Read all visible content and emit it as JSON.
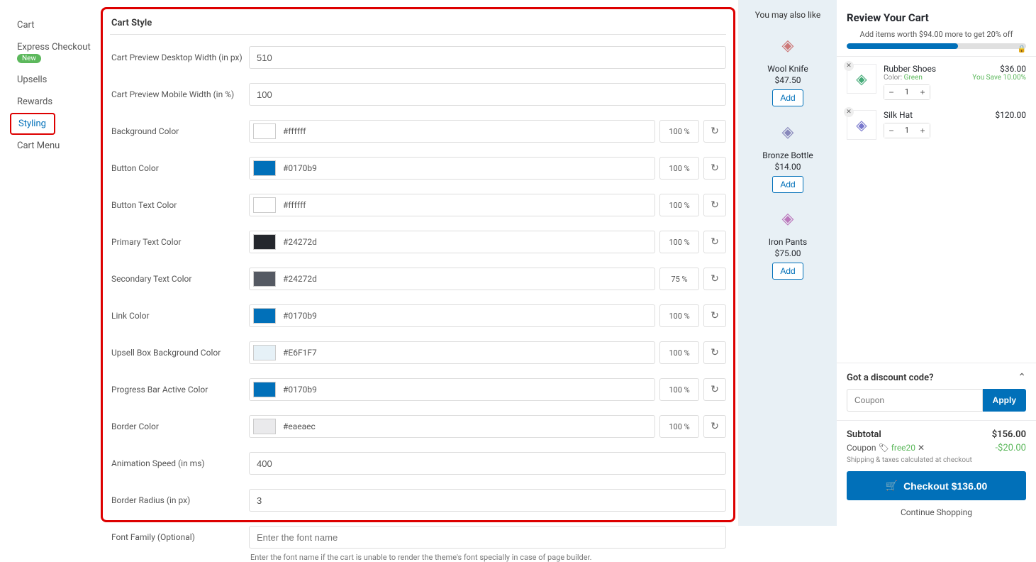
{
  "sidebar": {
    "items": [
      {
        "label": "Cart"
      },
      {
        "label": "Express Checkout",
        "badge": "New"
      },
      {
        "label": "Upsells"
      },
      {
        "label": "Rewards"
      },
      {
        "label": "Styling",
        "active": true
      },
      {
        "label": "Cart Menu"
      }
    ]
  },
  "panel": {
    "title": "Cart Style",
    "fields": {
      "desktop_width": {
        "label": "Cart Preview Desktop Width (in px)",
        "value": "510"
      },
      "mobile_width": {
        "label": "Cart Preview Mobile Width (in %)",
        "value": "100"
      },
      "bg_color": {
        "label": "Background Color",
        "hex": "#ffffff",
        "pct": "100 %",
        "swatch": "#ffffff"
      },
      "btn_color": {
        "label": "Button Color",
        "hex": "#0170b9",
        "pct": "100 %",
        "swatch": "#0170b9"
      },
      "btn_text_color": {
        "label": "Button Text Color",
        "hex": "#ffffff",
        "pct": "100 %",
        "swatch": "#ffffff"
      },
      "primary_text": {
        "label": "Primary Text Color",
        "hex": "#24272d",
        "pct": "100 %",
        "swatch": "#24272d"
      },
      "secondary_text": {
        "label": "Secondary Text Color",
        "hex": "#24272d",
        "pct": "75 %",
        "swatch": "#555a63"
      },
      "link_color": {
        "label": "Link Color",
        "hex": "#0170b9",
        "pct": "100 %",
        "swatch": "#0170b9"
      },
      "upsell_bg": {
        "label": "Upsell Box Background Color",
        "hex": "#E6F1F7",
        "pct": "100 %",
        "swatch": "#E6F1F7"
      },
      "progress_active": {
        "label": "Progress Bar Active Color",
        "hex": "#0170b9",
        "pct": "100 %",
        "swatch": "#0170b9"
      },
      "border_color": {
        "label": "Border Color",
        "hex": "#eaeaec",
        "pct": "100 %",
        "swatch": "#eaeaec"
      },
      "anim_speed": {
        "label": "Animation Speed (in ms)",
        "value": "400"
      },
      "border_radius": {
        "label": "Border Radius (in px)",
        "value": "3"
      },
      "font_family": {
        "label": "Font Family (Optional)",
        "placeholder": "Enter the font name",
        "helper": "Enter the font name if the cart is unable to render the theme's font specially in case of page builder."
      }
    }
  },
  "preview": {
    "upsells": {
      "title": "You may also like",
      "add_label": "Add",
      "items": [
        {
          "name": "Wool Knife",
          "price": "$47.50",
          "icon_color": "#c77"
        },
        {
          "name": "Bronze Bottle",
          "price": "$14.00",
          "icon_color": "#88b"
        },
        {
          "name": "Iron Pants",
          "price": "$75.00",
          "icon_color": "#b7b"
        }
      ]
    },
    "cart": {
      "title": "Review Your Cart",
      "promo": "Add items worth $94.00 more to get 20% off",
      "items": [
        {
          "name": "Rubber Shoes",
          "meta_label": "Color:",
          "meta_value": "Green",
          "price": "$36.00",
          "save": "You Save 10.00%",
          "qty": "1"
        },
        {
          "name": "Silk Hat",
          "meta_label": "",
          "meta_value": "",
          "price": "$120.00",
          "save": "",
          "qty": "1"
        }
      ],
      "discount": {
        "title": "Got a discount code?",
        "placeholder": "Coupon",
        "apply": "Apply"
      },
      "totals": {
        "subtotal_label": "Subtotal",
        "subtotal_value": "$156.00",
        "coupon_label": "Coupon",
        "coupon_code": "free20",
        "coupon_value": "-$20.00",
        "shipping_note": "Shipping & taxes calculated at checkout",
        "checkout": "Checkout  $136.00",
        "continue": "Continue Shopping"
      }
    }
  }
}
